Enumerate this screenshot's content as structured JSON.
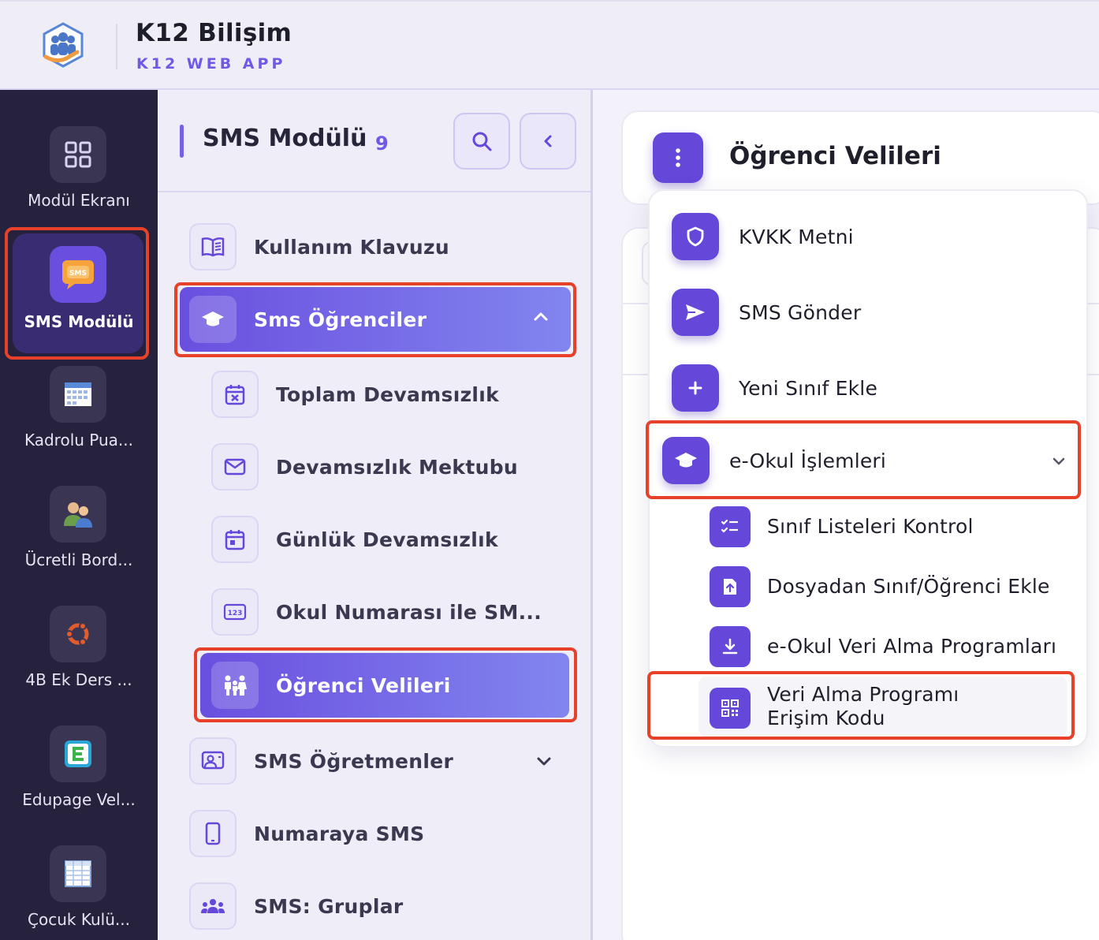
{
  "app": {
    "title": "K12 Bilişim",
    "subtitle": "K12 WEB APP"
  },
  "rail": {
    "items": [
      {
        "label": "Modül Ekranı",
        "icon": "grid-icon"
      },
      {
        "label": "SMS Modülü",
        "icon": "sms-icon",
        "active": true
      },
      {
        "label": "Kadrolu Pua...",
        "icon": "calendar-sheet-icon"
      },
      {
        "label": "Ücretli Bord...",
        "icon": "users-icon"
      },
      {
        "label": "4B Ek Ders ...",
        "icon": "ubuntu-icon"
      },
      {
        "label": "Edupage Vel...",
        "icon": "edupage-icon"
      },
      {
        "label": "Çocuk Kulü...",
        "icon": "spreadsheet-icon"
      }
    ]
  },
  "panel": {
    "title": "SMS Modülü",
    "count": "9",
    "items": [
      {
        "label": "Kullanım Klavuzu",
        "icon": "book-icon"
      },
      {
        "label": "Sms Öğrenciler",
        "icon": "graduation-cap-icon",
        "expanded": true
      },
      {
        "label": "Toplam Devamsızlık",
        "icon": "calendar-x-icon"
      },
      {
        "label": "Devamsızlık Mektubu",
        "icon": "envelope-icon"
      },
      {
        "label": "Günlük Devamsızlık",
        "icon": "calendar-day-icon"
      },
      {
        "label": "Okul Numarası ile SM...",
        "icon": "numbers-123-icon"
      },
      {
        "label": "Öğrenci Velileri",
        "icon": "family-icon",
        "active": true
      },
      {
        "label": "SMS Öğretmenler",
        "icon": "teacher-icon"
      },
      {
        "label": "Numaraya SMS",
        "icon": "phone-icon"
      },
      {
        "label": "SMS: Gruplar",
        "icon": "group-icon"
      }
    ]
  },
  "content": {
    "title": "Öğrenci Velileri"
  },
  "dropdown": {
    "items": [
      {
        "label": "KVKK Metni",
        "icon": "shield-icon"
      },
      {
        "label": "SMS Gönder",
        "icon": "send-icon"
      },
      {
        "label": "Yeni Sınıf Ekle",
        "icon": "plus-icon"
      },
      {
        "label": "e-Okul İşlemleri",
        "icon": "graduation-cap-icon",
        "expandable": true
      },
      {
        "label": "Sınıf Listeleri Kontrol",
        "icon": "checklist-icon"
      },
      {
        "label": "Dosyadan Sınıf/Öğrenci Ekle",
        "icon": "file-upload-icon"
      },
      {
        "label": "e-Okul Veri Alma Programları",
        "icon": "download-icon"
      },
      {
        "label": "Veri Alma Programı Erişim Kodu",
        "icon": "qr-code-icon"
      }
    ]
  },
  "colors": {
    "accent": "#6548d9",
    "highlight": "#e8412a",
    "rail_bg": "#26223d"
  }
}
